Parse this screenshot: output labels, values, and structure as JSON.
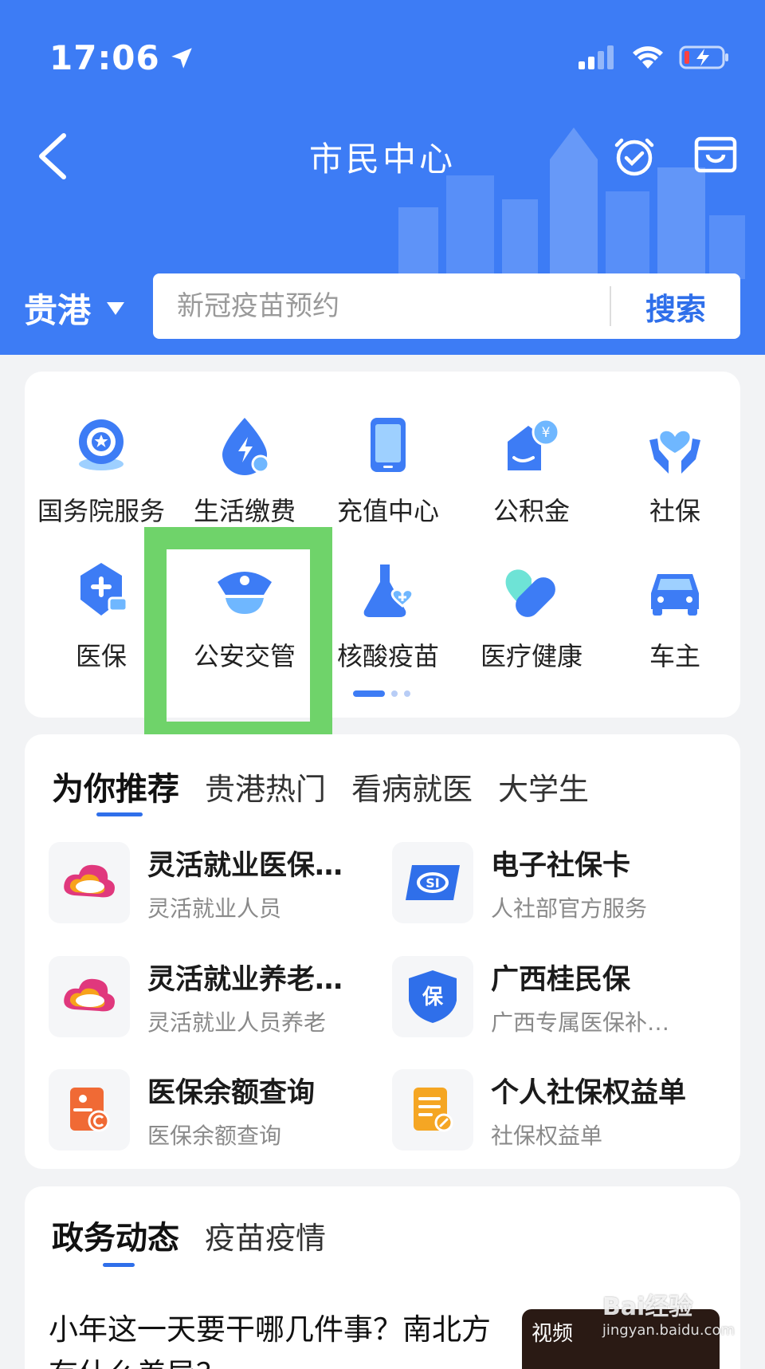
{
  "status": {
    "time": "17:06"
  },
  "nav": {
    "title": "市民中心"
  },
  "location": {
    "city": "贵港"
  },
  "search": {
    "placeholder": "新冠疫苗预约",
    "button": "搜索"
  },
  "services": [
    {
      "label": "国务院服务",
      "icon": "state-council-icon"
    },
    {
      "label": "生活缴费",
      "icon": "utility-bill-icon"
    },
    {
      "label": "充值中心",
      "icon": "phone-recharge-icon"
    },
    {
      "label": "公积金",
      "icon": "housing-fund-icon"
    },
    {
      "label": "社保",
      "icon": "social-security-icon"
    },
    {
      "label": "医保",
      "icon": "medical-insurance-icon"
    },
    {
      "label": "公安交管",
      "icon": "police-cap-icon"
    },
    {
      "label": "核酸疫苗",
      "icon": "flask-icon"
    },
    {
      "label": "医疗健康",
      "icon": "health-heart-icon"
    },
    {
      "label": "车主",
      "icon": "car-icon"
    }
  ],
  "pager": {
    "current": 1,
    "total": 3
  },
  "recommend": {
    "tabs": [
      "为你推荐",
      "贵港热门",
      "看病就医",
      "大学生"
    ],
    "items": [
      {
        "title": "灵活就业医保…",
        "subtitle": "灵活就业人员",
        "icon": "cloud-logo-icon"
      },
      {
        "title": "电子社保卡",
        "subtitle": "人社部官方服务",
        "icon": "social-card-icon"
      },
      {
        "title": "灵活就业养老…",
        "subtitle": "灵活就业人员养老",
        "icon": "cloud-logo-icon"
      },
      {
        "title": "广西桂民保",
        "subtitle": "广西专属医保补…",
        "icon": "shield-bao-icon"
      },
      {
        "title": "医保余额查询",
        "subtitle": "医保余额查询",
        "icon": "balance-query-icon"
      },
      {
        "title": "个人社保权益单",
        "subtitle": "社保权益单",
        "icon": "document-icon"
      }
    ]
  },
  "news": {
    "tabs": [
      "政务动态",
      "疫苗疫情"
    ],
    "headline": "小年这一天要干哪几件事？南北方有什么差异？",
    "thumb_badge": "视频"
  },
  "watermark": {
    "brand": "Bai经验",
    "url": "jingyan.baidu.com"
  },
  "colors": {
    "primary": "#3d7cf5",
    "highlight": "#6fd36a",
    "background": "#f2f3f5"
  }
}
